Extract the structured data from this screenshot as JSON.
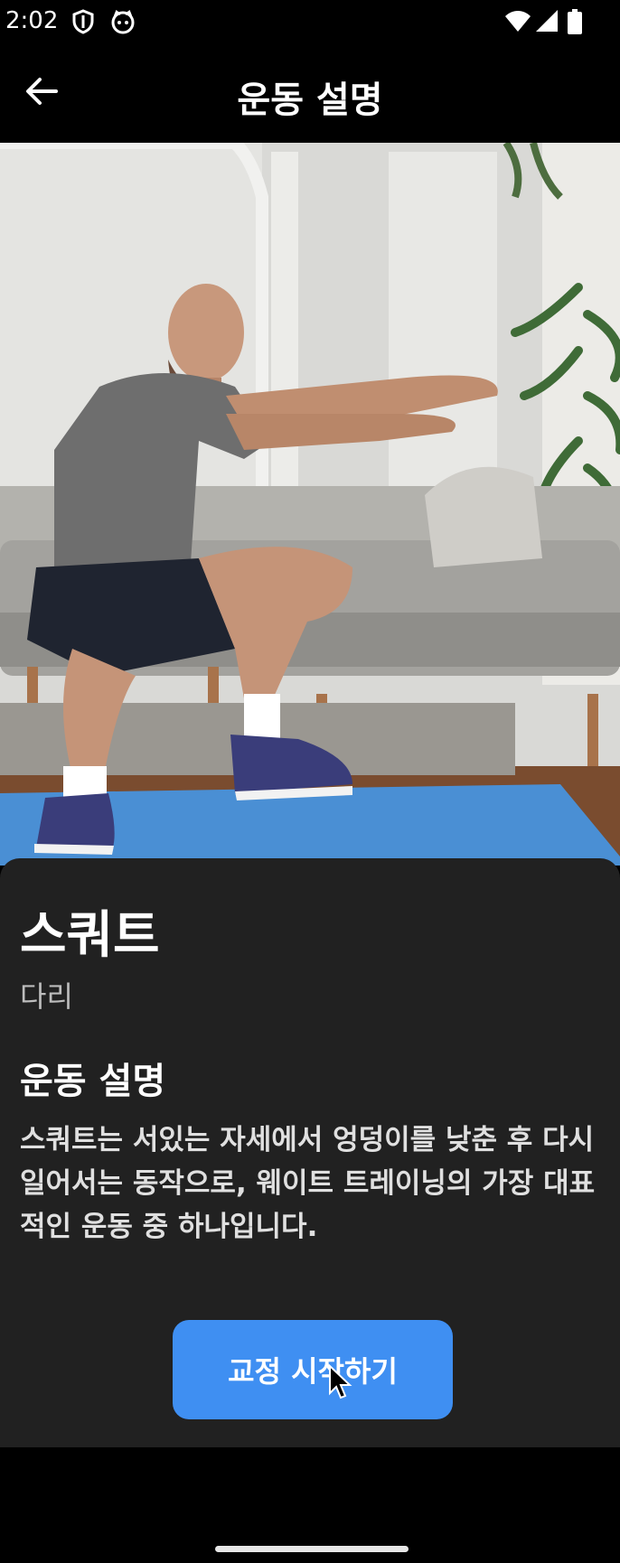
{
  "status_bar": {
    "time": "2:02",
    "icons": [
      "shield-icon",
      "cat-icon",
      "wifi-icon",
      "signal-icon",
      "battery-icon"
    ]
  },
  "app_bar": {
    "title": "운동 설명",
    "back_icon": "arrow-left-icon"
  },
  "hero": {
    "image": "man-doing-squat-photo"
  },
  "exercise": {
    "name": "스쿼트",
    "body_part": "다리",
    "section_title": "운동 설명",
    "description": "스쿼트는 서있는 자세에서 엉덩이를 낮춘 후 다시 일어서는 동작으로, 웨이트 트레이닝의 가장 대표적인 운동 중 하나입니다."
  },
  "actions": {
    "start_label": "교정 시작하기"
  },
  "colors": {
    "accent": "#3f8ff2",
    "sheet": "#212121",
    "background": "#000000"
  }
}
